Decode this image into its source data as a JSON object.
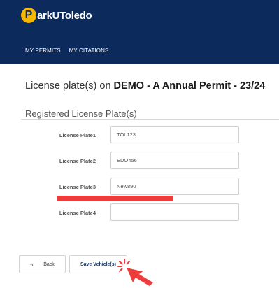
{
  "brand": {
    "logo_letter": "P",
    "logo_rest": "arkUToledo"
  },
  "nav": {
    "items": [
      "MY PERMITS",
      "MY CITATIONS"
    ]
  },
  "page": {
    "title_prefix": "License plate(s) on ",
    "title_permit": "DEMO - A Annual Permit - 23/24"
  },
  "section": {
    "title": "Registered License Plate(s)"
  },
  "plates": [
    {
      "label": "License Plate1",
      "value": "TOL123"
    },
    {
      "label": "License Plate2",
      "value": "EDO456"
    },
    {
      "label": "License Plate3",
      "value": "New890"
    },
    {
      "label": "License Plate4",
      "value": ""
    }
  ],
  "buttons": {
    "back_chevron": "«",
    "back_label": "Back",
    "save_label": "Save Vehicle(s)"
  },
  "colors": {
    "header_bg": "#0d2a5c",
    "logo_accent": "#f5b700",
    "highlight_bar": "#ee3b3b",
    "cursor": "#ee3b3b"
  },
  "icons": {
    "cursor": "pointer-arrow-icon",
    "click": "click-burst-icon"
  }
}
